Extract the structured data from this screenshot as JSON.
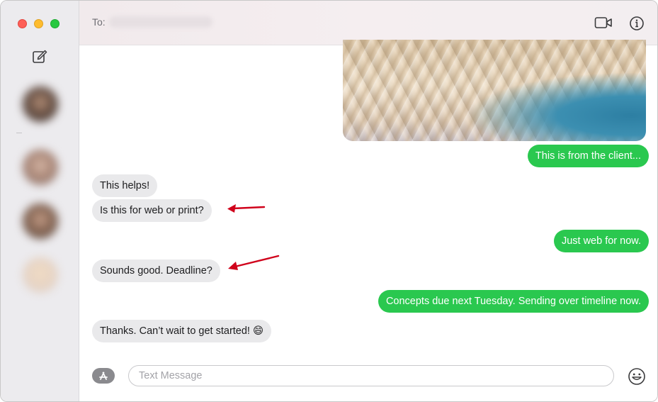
{
  "header": {
    "to_label": "To:",
    "icons": {
      "video": "video-camera-icon",
      "info": "info-circle-icon"
    }
  },
  "sidebar": {
    "icons": {
      "compose": "compose-icon"
    },
    "window_controls": [
      "close",
      "minimize",
      "zoom"
    ],
    "conversations": 4
  },
  "messages": [
    {
      "from": "me",
      "type": "image",
      "text": ""
    },
    {
      "from": "me",
      "type": "text",
      "text": "This is from the client..."
    },
    {
      "from": "them",
      "type": "text",
      "text": "This helps!"
    },
    {
      "from": "them",
      "type": "text",
      "text": "Is this for web or print?",
      "annotated": true
    },
    {
      "from": "me",
      "type": "text",
      "text": "Just web for now."
    },
    {
      "from": "them",
      "type": "text",
      "text": "Sounds good. Deadline?",
      "annotated": true
    },
    {
      "from": "me",
      "type": "text",
      "text": "Concepts due next Tuesday. Sending over timeline now."
    },
    {
      "from": "them",
      "type": "text",
      "text": "Thanks. Can’t wait to get started! 😄"
    }
  ],
  "input": {
    "placeholder": "Text Message",
    "value": "",
    "icons": {
      "apps": "app-store-icon",
      "emoji": "emoji-smile-icon"
    }
  },
  "colors": {
    "outgoing_bubble": "#2ac84f",
    "incoming_bubble": "#e9e9eb",
    "annotation_arrow": "#d0021b"
  }
}
